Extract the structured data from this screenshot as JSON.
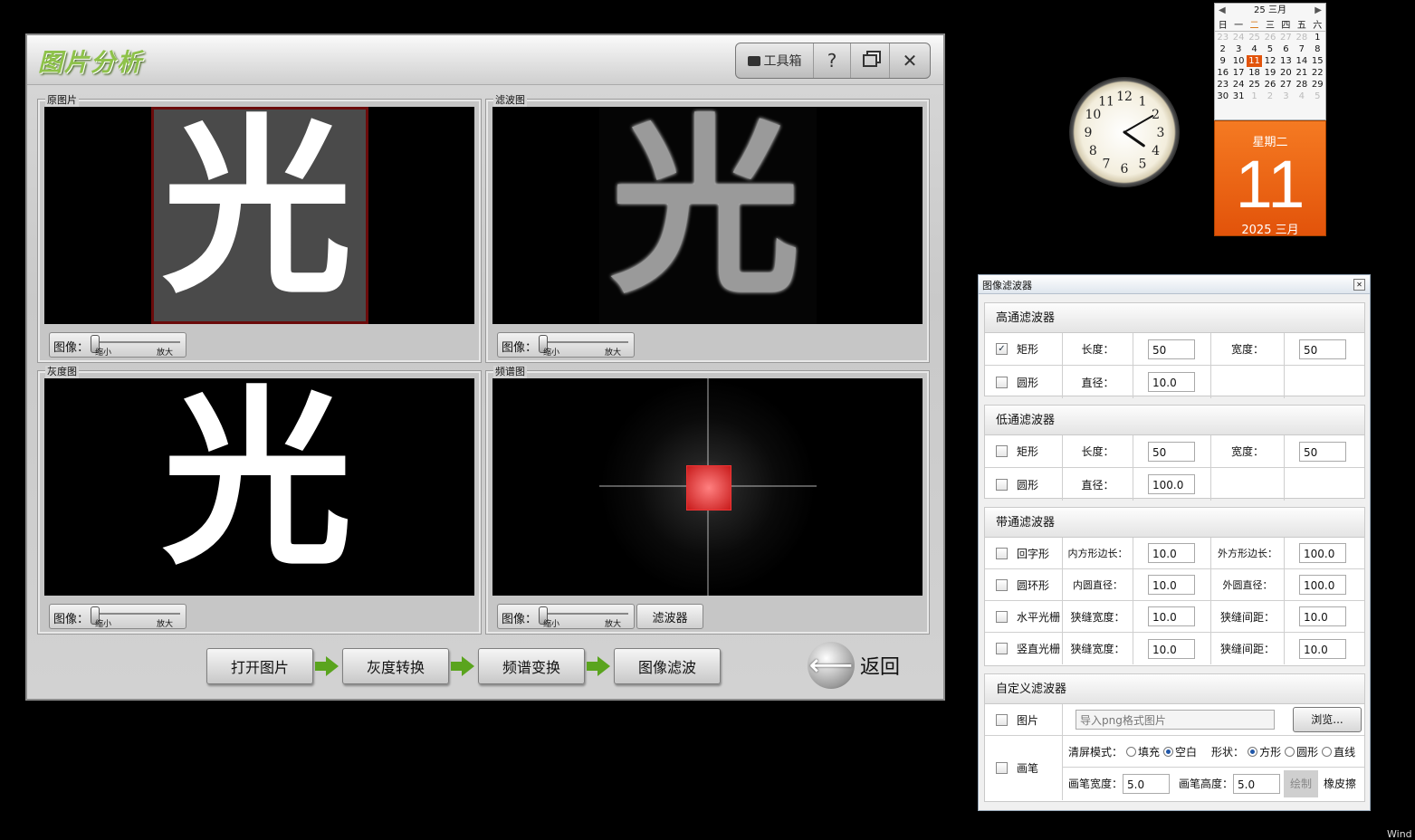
{
  "main_window": {
    "title": "图片分析",
    "toolbox_label": "工具箱",
    "help_label": "?",
    "panels": {
      "original": {
        "label": "原图片"
      },
      "filtered": {
        "label": "滤波图"
      },
      "gray": {
        "label": "灰度图"
      },
      "spectrum": {
        "label": "频谱图"
      }
    },
    "zoom": {
      "label": "图像：",
      "min": "缩小",
      "max": "放大"
    },
    "filter_button": "滤波器",
    "image_glyph": "光",
    "steps": [
      "打开图片",
      "灰度转换",
      "频谱变换",
      "图像滤波"
    ],
    "back_label": "返回"
  },
  "filter_window": {
    "title": "图像滤波器",
    "high_pass": {
      "title": "高通滤波器",
      "rect": {
        "label": "矩形",
        "checked": true,
        "length_label": "长度：",
        "length": "50",
        "width_label": "宽度：",
        "width": "50"
      },
      "circle": {
        "label": "圆形",
        "checked": false,
        "diameter_label": "直径：",
        "diameter": "10.0"
      }
    },
    "low_pass": {
      "title": "低通滤波器",
      "rect": {
        "label": "矩形",
        "checked": false,
        "length_label": "长度：",
        "length": "50",
        "width_label": "宽度：",
        "width": "50"
      },
      "circle": {
        "label": "圆形",
        "checked": false,
        "diameter_label": "直径：",
        "diameter": "100.0"
      }
    },
    "band_pass": {
      "title": "带通滤波器",
      "square_ring": {
        "label": "回字形",
        "inner_label": "内方形边长：",
        "inner": "10.0",
        "outer_label": "外方形边长：",
        "outer": "100.0"
      },
      "ring": {
        "label": "圆环形",
        "inner_label": "内圆直径：",
        "inner": "10.0",
        "outer_label": "外圆直径：",
        "outer": "100.0"
      },
      "h_grating": {
        "label": "水平光栅",
        "slit_w_label": "狭缝宽度：",
        "slit_w": "10.0",
        "slit_gap_label": "狭缝间距：",
        "slit_gap": "10.0"
      },
      "v_grating": {
        "label": "竖直光栅",
        "slit_w_label": "狭缝宽度：",
        "slit_w": "10.0",
        "slit_gap_label": "狭缝间距：",
        "slit_gap": "10.0"
      }
    },
    "custom": {
      "title": "自定义滤波器",
      "image": {
        "label": "图片",
        "placeholder": "导入png格式图片",
        "browse": "浏览..."
      },
      "brush": {
        "label": "画笔",
        "clear_mode_label": "清屏模式：",
        "fill": "填充",
        "blank": "空白",
        "shape_label": "形状：",
        "square": "方形",
        "circle": "圆形",
        "line": "直线",
        "width_label": "画笔宽度：",
        "width": "5.0",
        "height_label": "画笔高度：",
        "height": "5.0",
        "draw": "绘制",
        "eraser": "橡皮擦"
      }
    }
  },
  "calendar": {
    "month_header": "25 三月",
    "weekdays": [
      "日",
      "一",
      "二",
      "三",
      "四",
      "五",
      "六"
    ],
    "weeks": [
      [
        "23",
        "24",
        "25",
        "26",
        "27",
        "28",
        "1"
      ],
      [
        "2",
        "3",
        "4",
        "5",
        "6",
        "7",
        "8"
      ],
      [
        "9",
        "10",
        "11",
        "12",
        "13",
        "14",
        "15"
      ],
      [
        "16",
        "17",
        "18",
        "19",
        "20",
        "21",
        "22"
      ],
      [
        "23",
        "24",
        "25",
        "26",
        "27",
        "28",
        "29"
      ],
      [
        "30",
        "31",
        "1",
        "2",
        "3",
        "4",
        "5"
      ]
    ],
    "weekday_name": "星期二",
    "day": "11",
    "year_month": "2025 三月"
  },
  "clock": {
    "numbers": [
      "12",
      "1",
      "2",
      "3",
      "4",
      "5",
      "6",
      "7",
      "8",
      "9",
      "10",
      "11"
    ],
    "hour": 4,
    "minute": 10
  },
  "taskbar_text": "Wind"
}
